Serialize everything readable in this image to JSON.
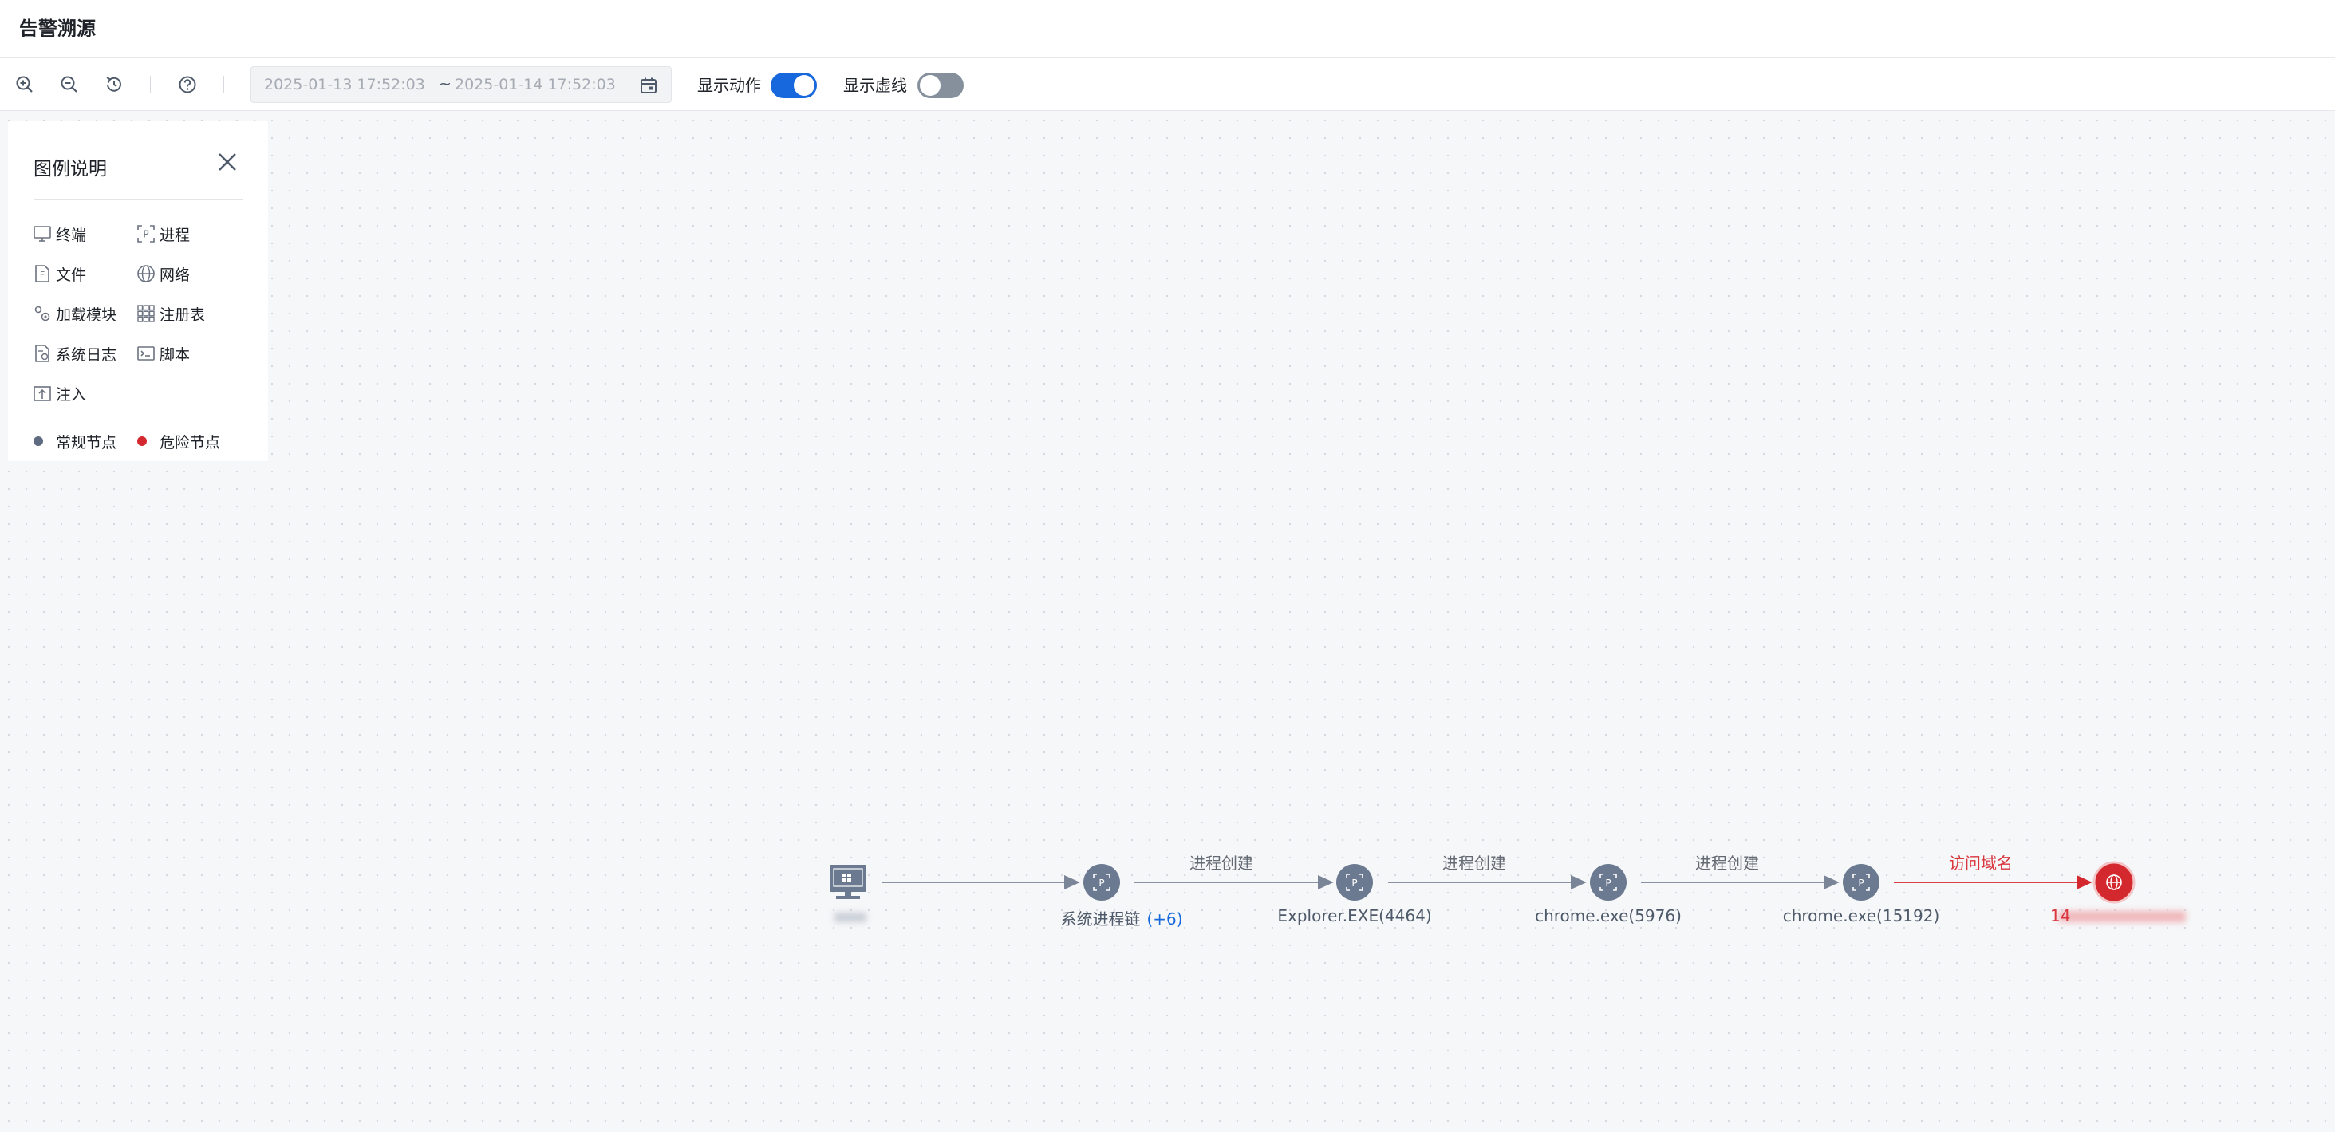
{
  "header": {
    "title": "告警溯源"
  },
  "toolbar": {
    "icons": [
      "zoom-in-icon",
      "zoom-out-icon",
      "reset-view-icon",
      "help-icon"
    ],
    "date_start": "2025-01-13 17:52:03",
    "date_separator": "~",
    "date_end": "2025-01-14 17:52:03",
    "show_action_label": "显示动作",
    "show_action_on": true,
    "show_dashed_label": "显示虚线",
    "show_dashed_on": false
  },
  "legend": {
    "title": "图例说明",
    "items": [
      {
        "icon": "terminal-icon",
        "label": "终端"
      },
      {
        "icon": "process-icon",
        "label": "进程"
      },
      {
        "icon": "file-icon",
        "label": "文件"
      },
      {
        "icon": "network-icon",
        "label": "网络"
      },
      {
        "icon": "module-icon",
        "label": "加载模块"
      },
      {
        "icon": "registry-icon",
        "label": "注册表"
      },
      {
        "icon": "syslog-icon",
        "label": "系统日志"
      },
      {
        "icon": "script-icon",
        "label": "脚本"
      },
      {
        "icon": "inject-icon",
        "label": "注入"
      }
    ],
    "normal_node_label": "常规节点",
    "danger_node_label": "危险节点",
    "normal_color": "#6b7a90",
    "danger_color": "#d4282f"
  },
  "graph": {
    "nodes": [
      {
        "type": "terminal",
        "label": ""
      },
      {
        "type": "process",
        "label": "系统进程链",
        "badge": "(+6)"
      },
      {
        "type": "process",
        "label": "Explorer.EXE(4464)"
      },
      {
        "type": "process",
        "label": "chrome.exe(5976)"
      },
      {
        "type": "process",
        "label": "chrome.exe(15192)"
      },
      {
        "type": "network",
        "label": "14",
        "danger": true
      }
    ],
    "edges": [
      {
        "label": ""
      },
      {
        "label": "进程创建"
      },
      {
        "label": "进程创建"
      },
      {
        "label": "进程创建"
      },
      {
        "label": "访问域名",
        "danger": true
      }
    ],
    "edge_color": "#7a8597",
    "danger_color": "#d4282f",
    "node_color": "#6b7a90"
  }
}
